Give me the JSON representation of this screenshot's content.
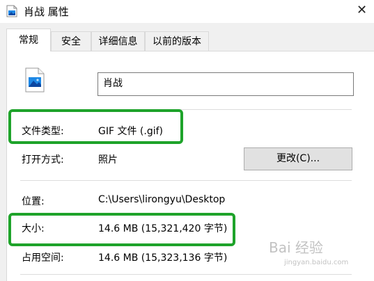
{
  "window": {
    "title": "肖战 属性",
    "close_glyph": "✕"
  },
  "tabs": [
    {
      "label": "常规",
      "active": true
    },
    {
      "label": "安全",
      "active": false
    },
    {
      "label": "详细信息",
      "active": false
    },
    {
      "label": "以前的版本",
      "active": false
    }
  ],
  "file": {
    "name": "肖战",
    "icon": "image-file-icon"
  },
  "fields": {
    "type_label": "文件类型:",
    "type_value": "GIF 文件 (.gif)",
    "open_label": "打开方式:",
    "open_value": "照片",
    "change_button": "更改(C)...",
    "location_label": "位置:",
    "location_value": "C:\\Users\\lirongyu\\Desktop",
    "size_label": "大小:",
    "size_value": "14.6 MB (15,321,420 字节)",
    "disk_label": "占用空间:",
    "disk_value": "14.6 MB (15,323,136 字节)"
  },
  "watermark": {
    "main": "Bai 经验",
    "sub": "jingyan.baidu.com"
  },
  "colors": {
    "highlight": "#1ea32a",
    "accent_blue": "#1e88e5"
  }
}
